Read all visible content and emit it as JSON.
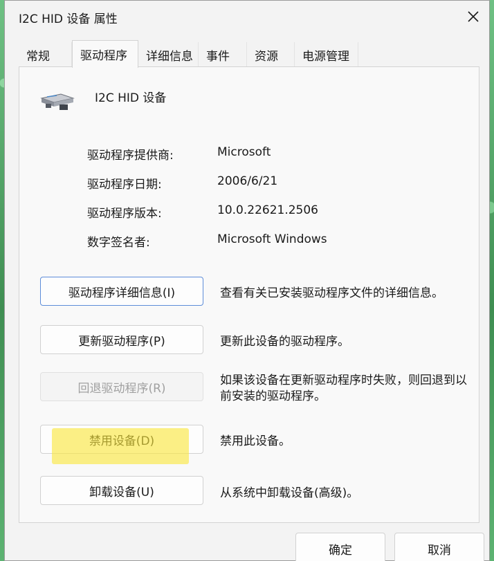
{
  "window": {
    "title": "I2C HID 设备 属性"
  },
  "tabs": [
    {
      "label": "常规"
    },
    {
      "label": "驱动程序"
    },
    {
      "label": "详细信息"
    },
    {
      "label": "事件"
    },
    {
      "label": "资源"
    },
    {
      "label": "电源管理"
    }
  ],
  "device": {
    "name": "I2C HID 设备",
    "icon": "hid-device-icon"
  },
  "properties": [
    {
      "label": "驱动程序提供商:",
      "value": "Microsoft"
    },
    {
      "label": "驱动程序日期:",
      "value": "2006/6/21"
    },
    {
      "label": "驱动程序版本:",
      "value": "10.0.22621.2506"
    },
    {
      "label": "数字签名者:",
      "value": "Microsoft Windows"
    }
  ],
  "actions": [
    {
      "button": "驱动程序详细信息(I)",
      "description": "查看有关已安装驱动程序文件的详细信息。"
    },
    {
      "button": "更新驱动程序(P)",
      "description": "更新此设备的驱动程序。"
    },
    {
      "button": "回退驱动程序(R)",
      "description": "如果该设备在更新驱动程序时失败，则回退到以前安装的驱动程序。"
    },
    {
      "button": "禁用设备(D)",
      "description": "禁用此设备。"
    },
    {
      "button": "卸载设备(U)",
      "description": "从系统中卸载设备(高级)。"
    }
  ],
  "footer": {
    "ok": "确定",
    "cancel": "取消"
  },
  "colors": {
    "highlight": "#fae63c",
    "focus_border": "#5b8bd8"
  }
}
